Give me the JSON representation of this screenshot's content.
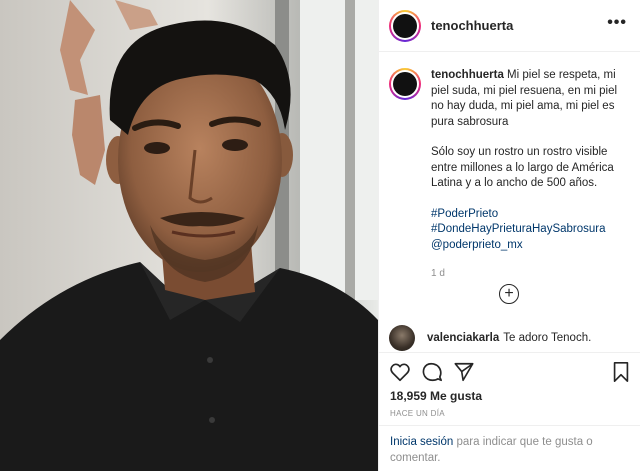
{
  "post": {
    "username": "tenochhuerta",
    "more_icon": "more-options-icon"
  },
  "caption": {
    "username": "tenochhuerta",
    "paragraph1": "Mi piel se respeta, mi piel suda, mi piel resuena, en mi piel no hay duda, mi piel ama, mi piel es pura sabrosura",
    "paragraph2": "Sólo soy un rostro un rostro visible entre millones a lo largo de América Latina y a lo ancho de 500 años.",
    "tags": [
      "#PoderPrieto",
      "#DondeHayPrieturaHaySabrosura",
      "@poderprieto_mx"
    ],
    "time": "1 d"
  },
  "comment": {
    "username": "valenciakarla",
    "text": "Te adoro Tenoch."
  },
  "actions": {
    "likes": "18,959 Me gusta",
    "posted_ago": "HACE UN DÍA",
    "login_link": "Inicia sesión",
    "login_text": "para indicar que te gusta o comentar."
  },
  "colors": {
    "link": "#00376b",
    "secondary_text": "#8e8e8e",
    "primary_text": "#262626",
    "divider": "#efefef"
  }
}
